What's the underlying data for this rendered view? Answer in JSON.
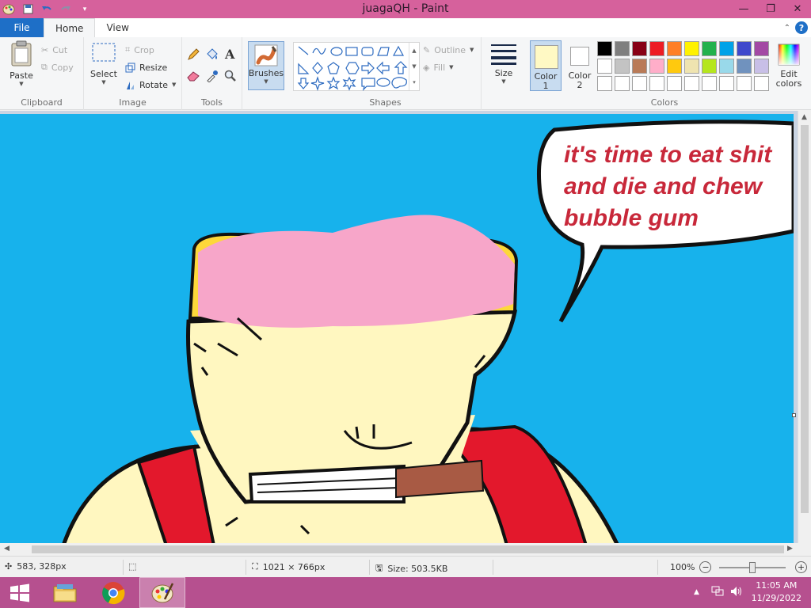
{
  "window": {
    "title": "juagaQH - Paint"
  },
  "tabs": {
    "file": "File",
    "home": "Home",
    "view": "View"
  },
  "clipboard": {
    "paste": "Paste",
    "cut": "Cut",
    "copy": "Copy",
    "label": "Clipboard"
  },
  "image": {
    "select": "Select",
    "crop": "Crop",
    "resize": "Resize",
    "rotate": "Rotate",
    "label": "Image"
  },
  "tools": {
    "label": "Tools",
    "brushes": "Brushes"
  },
  "shapes": {
    "outline": "Outline",
    "fill": "Fill",
    "label": "Shapes"
  },
  "size": {
    "label": "Size"
  },
  "colors": {
    "color1_label": "Color",
    "color1_num": "1",
    "color2_label": "Color",
    "color2_num": "2",
    "edit_label_1": "Edit",
    "edit_label_2": "colors",
    "label": "Colors",
    "color1": "#fff9c4",
    "color2": "#ffffff",
    "palette_row1": [
      "#000000",
      "#7f7f7f",
      "#880015",
      "#ed1c24",
      "#ff7f27",
      "#fff200",
      "#22b14c",
      "#00a2e8",
      "#3f48cc",
      "#a349a4"
    ],
    "palette_row2": [
      "#ffffff",
      "#c3c3c3",
      "#b97a57",
      "#ffaec9",
      "#ffc90e",
      "#efe4b0",
      "#b5e61d",
      "#99d9ea",
      "#7092be",
      "#c8bfe7"
    ],
    "palette_row3": [
      "#ffffff",
      "#ffffff",
      "#ffffff",
      "#ffffff",
      "#ffffff",
      "#ffffff",
      "#ffffff",
      "#ffffff",
      "#ffffff",
      "#ffffff"
    ]
  },
  "canvas": {
    "speech_line1": "it's time to eat shit",
    "speech_line2": "and die and chew",
    "speech_line3": "bubble gum"
  },
  "status": {
    "cursor_pos": "583, 328px",
    "dimensions": "1021 × 766px",
    "file_size": "Size: 503.5KB",
    "zoom": "100%"
  },
  "taskbar": {
    "time": "11:05 AM",
    "date": "11/29/2022"
  }
}
